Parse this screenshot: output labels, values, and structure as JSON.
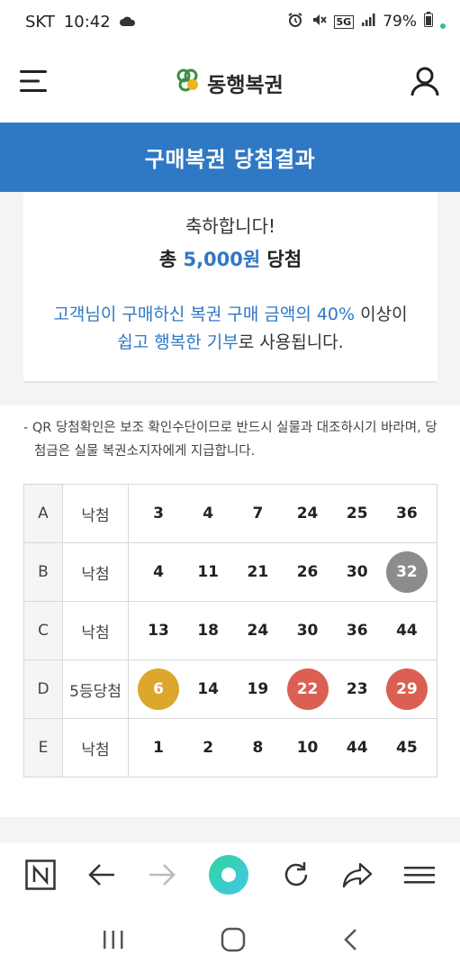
{
  "status_bar": {
    "carrier": "SKT",
    "time": "10:42",
    "network": "5G",
    "battery": "79%"
  },
  "header": {
    "logo_text": "동행복권",
    "menu_icon": "hamburger-icon",
    "user_icon": "user-icon"
  },
  "page_title": "구매복권 당첨결과",
  "result": {
    "congrats": "축하합니다!",
    "prize_prefix": "총 ",
    "prize_amount": "5,000원",
    "prize_suffix": " 당첨",
    "donate_line1_blue": "고객님이 구매하신 복권 구매 금액의 40%",
    "donate_line1_rest": " 이상이",
    "donate_line2_blue": "쉽고 행복한 기부",
    "donate_line2_rest": "로 사용됩니다."
  },
  "notice": "- QR 당첨확인은 보조 확인수단이므로 반드시 실물과 대조하시기 바라며, 당첨금은 실물 복권소지자에게 지급합니다.",
  "ticket_rows": [
    {
      "label": "A",
      "status": "낙첨",
      "numbers": [
        {
          "n": "3",
          "color": ""
        },
        {
          "n": "4",
          "color": ""
        },
        {
          "n": "7",
          "color": ""
        },
        {
          "n": "24",
          "color": ""
        },
        {
          "n": "25",
          "color": ""
        },
        {
          "n": "36",
          "color": ""
        }
      ]
    },
    {
      "label": "B",
      "status": "낙첨",
      "numbers": [
        {
          "n": "4",
          "color": ""
        },
        {
          "n": "11",
          "color": ""
        },
        {
          "n": "21",
          "color": ""
        },
        {
          "n": "26",
          "color": ""
        },
        {
          "n": "30",
          "color": ""
        },
        {
          "n": "32",
          "color": "#8c8c8c"
        }
      ]
    },
    {
      "label": "C",
      "status": "낙첨",
      "numbers": [
        {
          "n": "13",
          "color": ""
        },
        {
          "n": "18",
          "color": ""
        },
        {
          "n": "24",
          "color": ""
        },
        {
          "n": "30",
          "color": ""
        },
        {
          "n": "36",
          "color": ""
        },
        {
          "n": "44",
          "color": ""
        }
      ]
    },
    {
      "label": "D",
      "status": "5등당첨",
      "numbers": [
        {
          "n": "6",
          "color": "#dba72c"
        },
        {
          "n": "14",
          "color": ""
        },
        {
          "n": "19",
          "color": ""
        },
        {
          "n": "22",
          "color": "#db5f52"
        },
        {
          "n": "23",
          "color": ""
        },
        {
          "n": "29",
          "color": "#db5f52"
        }
      ]
    },
    {
      "label": "E",
      "status": "낙첨",
      "numbers": [
        {
          "n": "1",
          "color": ""
        },
        {
          "n": "2",
          "color": ""
        },
        {
          "n": "8",
          "color": ""
        },
        {
          "n": "10",
          "color": ""
        },
        {
          "n": "44",
          "color": ""
        },
        {
          "n": "45",
          "color": ""
        }
      ]
    }
  ],
  "colors": {
    "brand_blue": "#2f78c4",
    "ball_yellow": "#dba72c",
    "ball_red": "#db5f52",
    "ball_gray": "#8c8c8c"
  },
  "browser_toolbar": {
    "icons": [
      "naver-n-icon",
      "back-arrow-icon",
      "forward-arrow-icon",
      "home-circle-icon",
      "refresh-icon",
      "share-icon",
      "menu-icon"
    ]
  },
  "system_nav": {
    "icons": [
      "recent-apps-icon",
      "home-icon",
      "back-icon"
    ]
  }
}
